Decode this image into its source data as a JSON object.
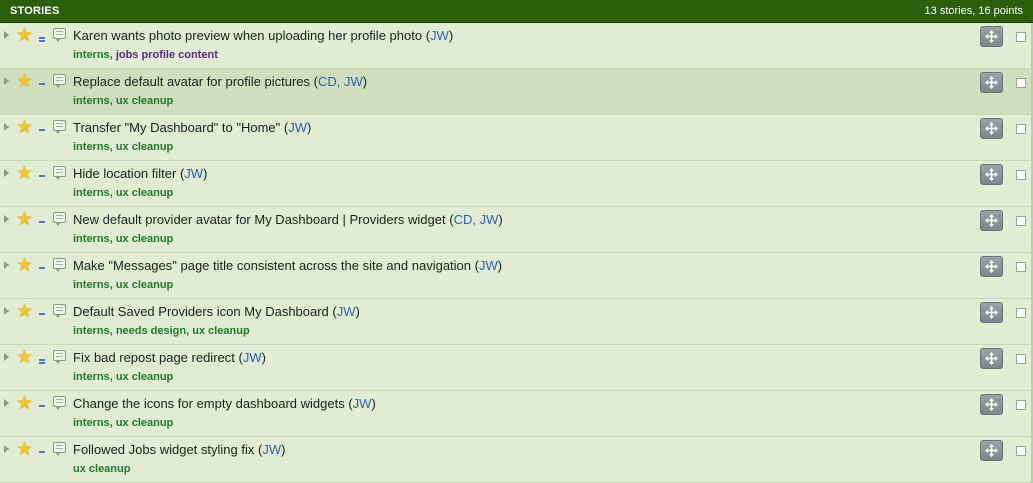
{
  "panel": {
    "title": "STORIES",
    "summary": "13 stories, 16 points"
  },
  "colors": {
    "header_bg": "#2b5f0c",
    "row_bg": "#e1ecd3",
    "row_selected_bg": "#cfdfbd",
    "label_green": "#1f7a2c",
    "label_purple": "#582b86",
    "owner_blue": "#2a62b5",
    "star": "#f2c12e"
  },
  "stories": [
    {
      "title": "Karen wants photo preview when uploading her profile photo",
      "owners": "JW",
      "estimate": 2,
      "labels": [
        {
          "text": "interns",
          "color": "green"
        },
        {
          "text": "jobs profile content",
          "color": "purple"
        }
      ],
      "selected": false
    },
    {
      "title": "Replace default avatar for profile pictures",
      "owners": "CD, JW",
      "estimate": 1,
      "labels": [
        {
          "text": "interns",
          "color": "green"
        },
        {
          "text": "ux cleanup",
          "color": "green"
        }
      ],
      "selected": true
    },
    {
      "title": "Transfer \"My Dashboard\" to \"Home\" ",
      "owners": "JW",
      "estimate": 1,
      "labels": [
        {
          "text": "interns",
          "color": "green"
        },
        {
          "text": "ux cleanup",
          "color": "green"
        }
      ],
      "selected": false
    },
    {
      "title": "Hide location filter",
      "owners": "JW",
      "estimate": 1,
      "labels": [
        {
          "text": "interns",
          "color": "green"
        },
        {
          "text": "ux cleanup",
          "color": "green"
        }
      ],
      "selected": false
    },
    {
      "title": "New default provider avatar for My Dashboard | Providers widget",
      "owners": "CD, JW",
      "estimate": 1,
      "labels": [
        {
          "text": "interns",
          "color": "green"
        },
        {
          "text": "ux cleanup",
          "color": "green"
        }
      ],
      "selected": false
    },
    {
      "title": "Make \"Messages\" page title consistent across the site and navigation",
      "owners": "JW",
      "estimate": 1,
      "labels": [
        {
          "text": "interns",
          "color": "green"
        },
        {
          "text": "ux cleanup",
          "color": "green"
        }
      ],
      "selected": false
    },
    {
      "title": "Default Saved Providers icon My Dashboard",
      "owners": "JW",
      "estimate": 1,
      "labels": [
        {
          "text": "interns",
          "color": "green"
        },
        {
          "text": "needs design",
          "color": "green"
        },
        {
          "text": "ux cleanup",
          "color": "green"
        }
      ],
      "selected": false
    },
    {
      "title": "Fix bad repost page redirect",
      "owners": "JW",
      "estimate": 2,
      "labels": [
        {
          "text": "interns",
          "color": "green"
        },
        {
          "text": "ux cleanup",
          "color": "green"
        }
      ],
      "selected": false
    },
    {
      "title": "Change the icons for empty dashboard widgets",
      "owners": "JW",
      "estimate": 1,
      "labels": [
        {
          "text": "interns",
          "color": "green"
        },
        {
          "text": "ux cleanup",
          "color": "green"
        }
      ],
      "selected": false
    },
    {
      "title": "Followed Jobs widget styling fix",
      "owners": "JW",
      "estimate": 1,
      "labels": [
        {
          "text": "ux cleanup",
          "color": "green"
        }
      ],
      "selected": false
    }
  ],
  "icons": {
    "expander": "triangle-right-icon",
    "star": "star-icon",
    "comment": "comment-icon",
    "move": "move-arrows-icon"
  }
}
